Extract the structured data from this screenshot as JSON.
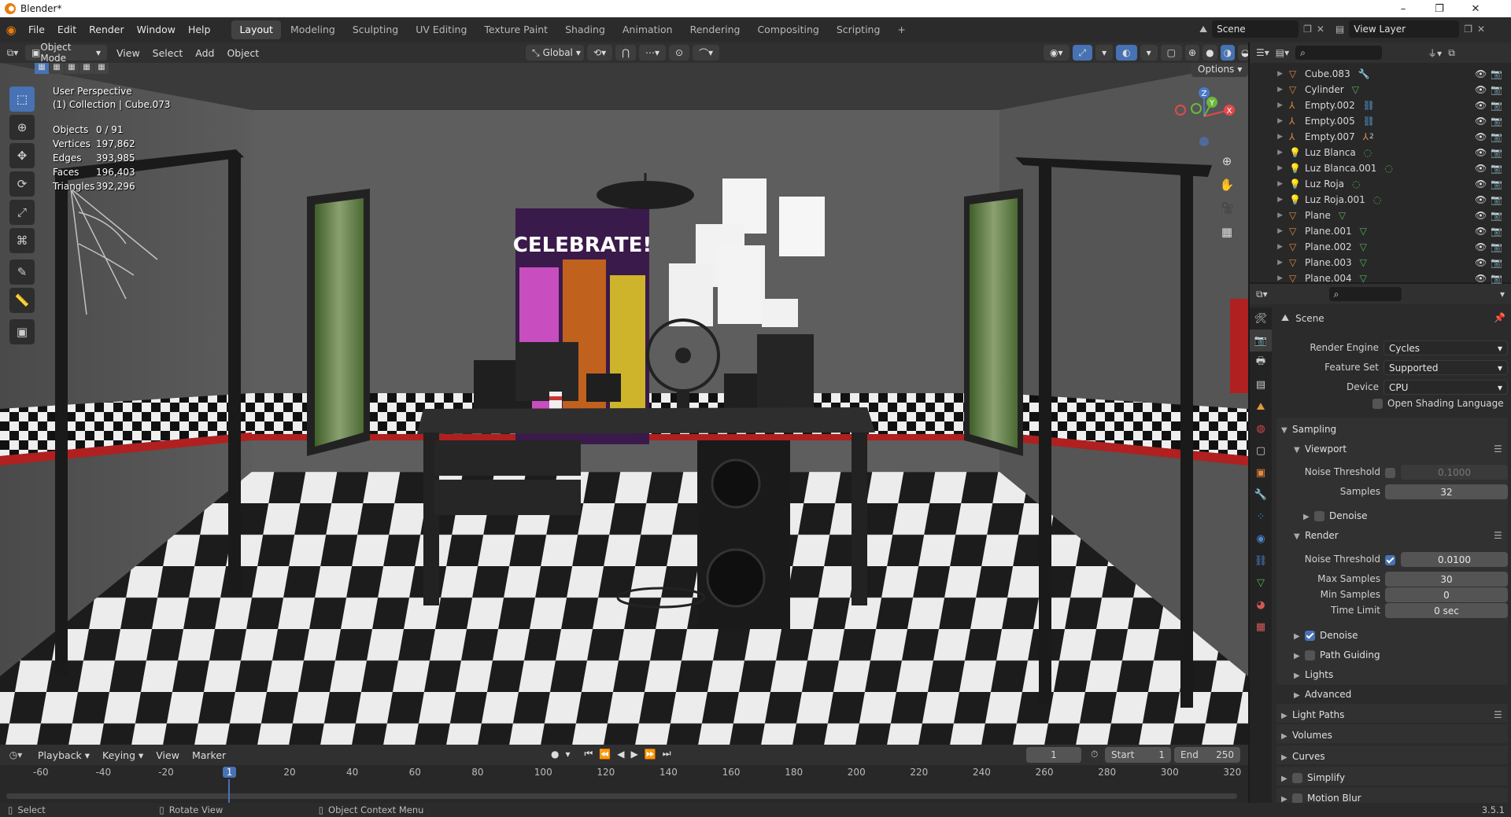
{
  "titlebar": {
    "title": "Blender*",
    "minimize": "–",
    "maximize": "❐",
    "close": "✕"
  },
  "menu": [
    "File",
    "Edit",
    "Render",
    "Window",
    "Help"
  ],
  "workspaces": [
    "Layout",
    "Modeling",
    "Sculpting",
    "UV Editing",
    "Texture Paint",
    "Shading",
    "Animation",
    "Rendering",
    "Compositing",
    "Scripting"
  ],
  "workspace_add": "+",
  "scene_selector": {
    "value": "Scene"
  },
  "view_layer_selector": {
    "value": "View Layer"
  },
  "viewport_header": {
    "mode": "Object Mode",
    "menus": [
      "View",
      "Select",
      "Add",
      "Object"
    ],
    "transform_orientation": "Global",
    "options": "Options"
  },
  "viewport_overlay": {
    "perspective": "User Perspective",
    "collection": "(1) Collection | Cube.073",
    "stats": [
      {
        "label": "Objects",
        "value": "0 / 91"
      },
      {
        "label": "Vertices",
        "value": "197,862"
      },
      {
        "label": "Edges",
        "value": "393,985"
      },
      {
        "label": "Faces",
        "value": "196,403"
      },
      {
        "label": "Triangles",
        "value": "392,296"
      }
    ],
    "poster_text": "CELEBRATE!",
    "gizmo": {
      "z": "Z",
      "y": "Y",
      "x": "X"
    }
  },
  "tools": [
    "select-box-icon",
    "cursor-icon",
    "move-icon",
    "rotate-icon",
    "scale-icon",
    "transform-icon",
    "annotate-icon",
    "measure-icon",
    "add-cube-icon"
  ],
  "timeline": {
    "menus": [
      "Playback",
      "Keying",
      "View",
      "Marker"
    ],
    "current_frame": "1",
    "start_label": "Start",
    "start": "1",
    "end_label": "End",
    "end": "250",
    "ruler": [
      "-60",
      "-40",
      "-20",
      "1",
      "20",
      "40",
      "60",
      "80",
      "100",
      "120",
      "140",
      "160",
      "180",
      "200",
      "220",
      "240",
      "260",
      "280",
      "300",
      "320"
    ]
  },
  "status_bar": {
    "items": [
      "Select",
      "Rotate View",
      "Object Context Menu"
    ],
    "version": "3.5.1"
  },
  "outliner": {
    "items": [
      {
        "name": "Cube.083",
        "type": "mesh",
        "extra": "modifier"
      },
      {
        "name": "Cylinder",
        "type": "mesh",
        "extra": "mesh"
      },
      {
        "name": "Empty.002",
        "type": "empty",
        "extra": "constraint"
      },
      {
        "name": "Empty.005",
        "type": "empty",
        "extra": "constraint"
      },
      {
        "name": "Empty.007",
        "type": "empty",
        "extra": "empty"
      },
      {
        "name": "Luz Blanca",
        "type": "light",
        "extra": "light"
      },
      {
        "name": "Luz Blanca.001",
        "type": "light",
        "extra": "light"
      },
      {
        "name": "Luz Roja",
        "type": "light",
        "extra": "light"
      },
      {
        "name": "Luz Roja.001",
        "type": "light",
        "extra": "light"
      },
      {
        "name": "Plane",
        "type": "mesh",
        "extra": "mesh"
      },
      {
        "name": "Plane.001",
        "type": "mesh",
        "extra": "mesh"
      },
      {
        "name": "Plane.002",
        "type": "mesh",
        "extra": "mesh"
      },
      {
        "name": "Plane.003",
        "type": "mesh",
        "extra": "mesh"
      },
      {
        "name": "Plane.004",
        "type": "mesh",
        "extra": "mesh"
      }
    ],
    "empty007_count": "2"
  },
  "properties": {
    "context": "Scene",
    "render_engine": {
      "label": "Render Engine",
      "value": "Cycles"
    },
    "feature_set": {
      "label": "Feature Set",
      "value": "Supported"
    },
    "device": {
      "label": "Device",
      "value": "CPU"
    },
    "osl": {
      "label": "Open Shading Language",
      "checked": false
    },
    "sampling": {
      "title": "Sampling",
      "viewport": {
        "title": "Viewport",
        "noise_threshold_label": "Noise Threshold",
        "noise_threshold": "0.1000",
        "noise_enabled": false,
        "samples_label": "Samples",
        "samples": "32",
        "denoise": "Denoise"
      },
      "render": {
        "title": "Render",
        "noise_threshold_label": "Noise Threshold",
        "noise_threshold": "0.0100",
        "noise_enabled": true,
        "max_samples_label": "Max Samples",
        "max_samples": "30",
        "min_samples_label": "Min Samples",
        "min_samples": "0",
        "time_limit_label": "Time Limit",
        "time_limit": "0 sec"
      },
      "subpanels": [
        {
          "label": "Denoise",
          "checkbox": true,
          "checked": true
        },
        {
          "label": "Path Guiding",
          "checkbox": true,
          "checked": false
        },
        {
          "label": "Lights",
          "checkbox": false
        },
        {
          "label": "Advanced",
          "checkbox": false
        }
      ]
    },
    "panels": [
      {
        "label": "Light Paths"
      },
      {
        "label": "Volumes"
      },
      {
        "label": "Curves"
      },
      {
        "label": "Simplify"
      },
      {
        "label": "Motion Blur"
      }
    ]
  },
  "colors": {
    "accent": "#4772b3",
    "header": "#303030",
    "panel": "#2b2b2b"
  }
}
